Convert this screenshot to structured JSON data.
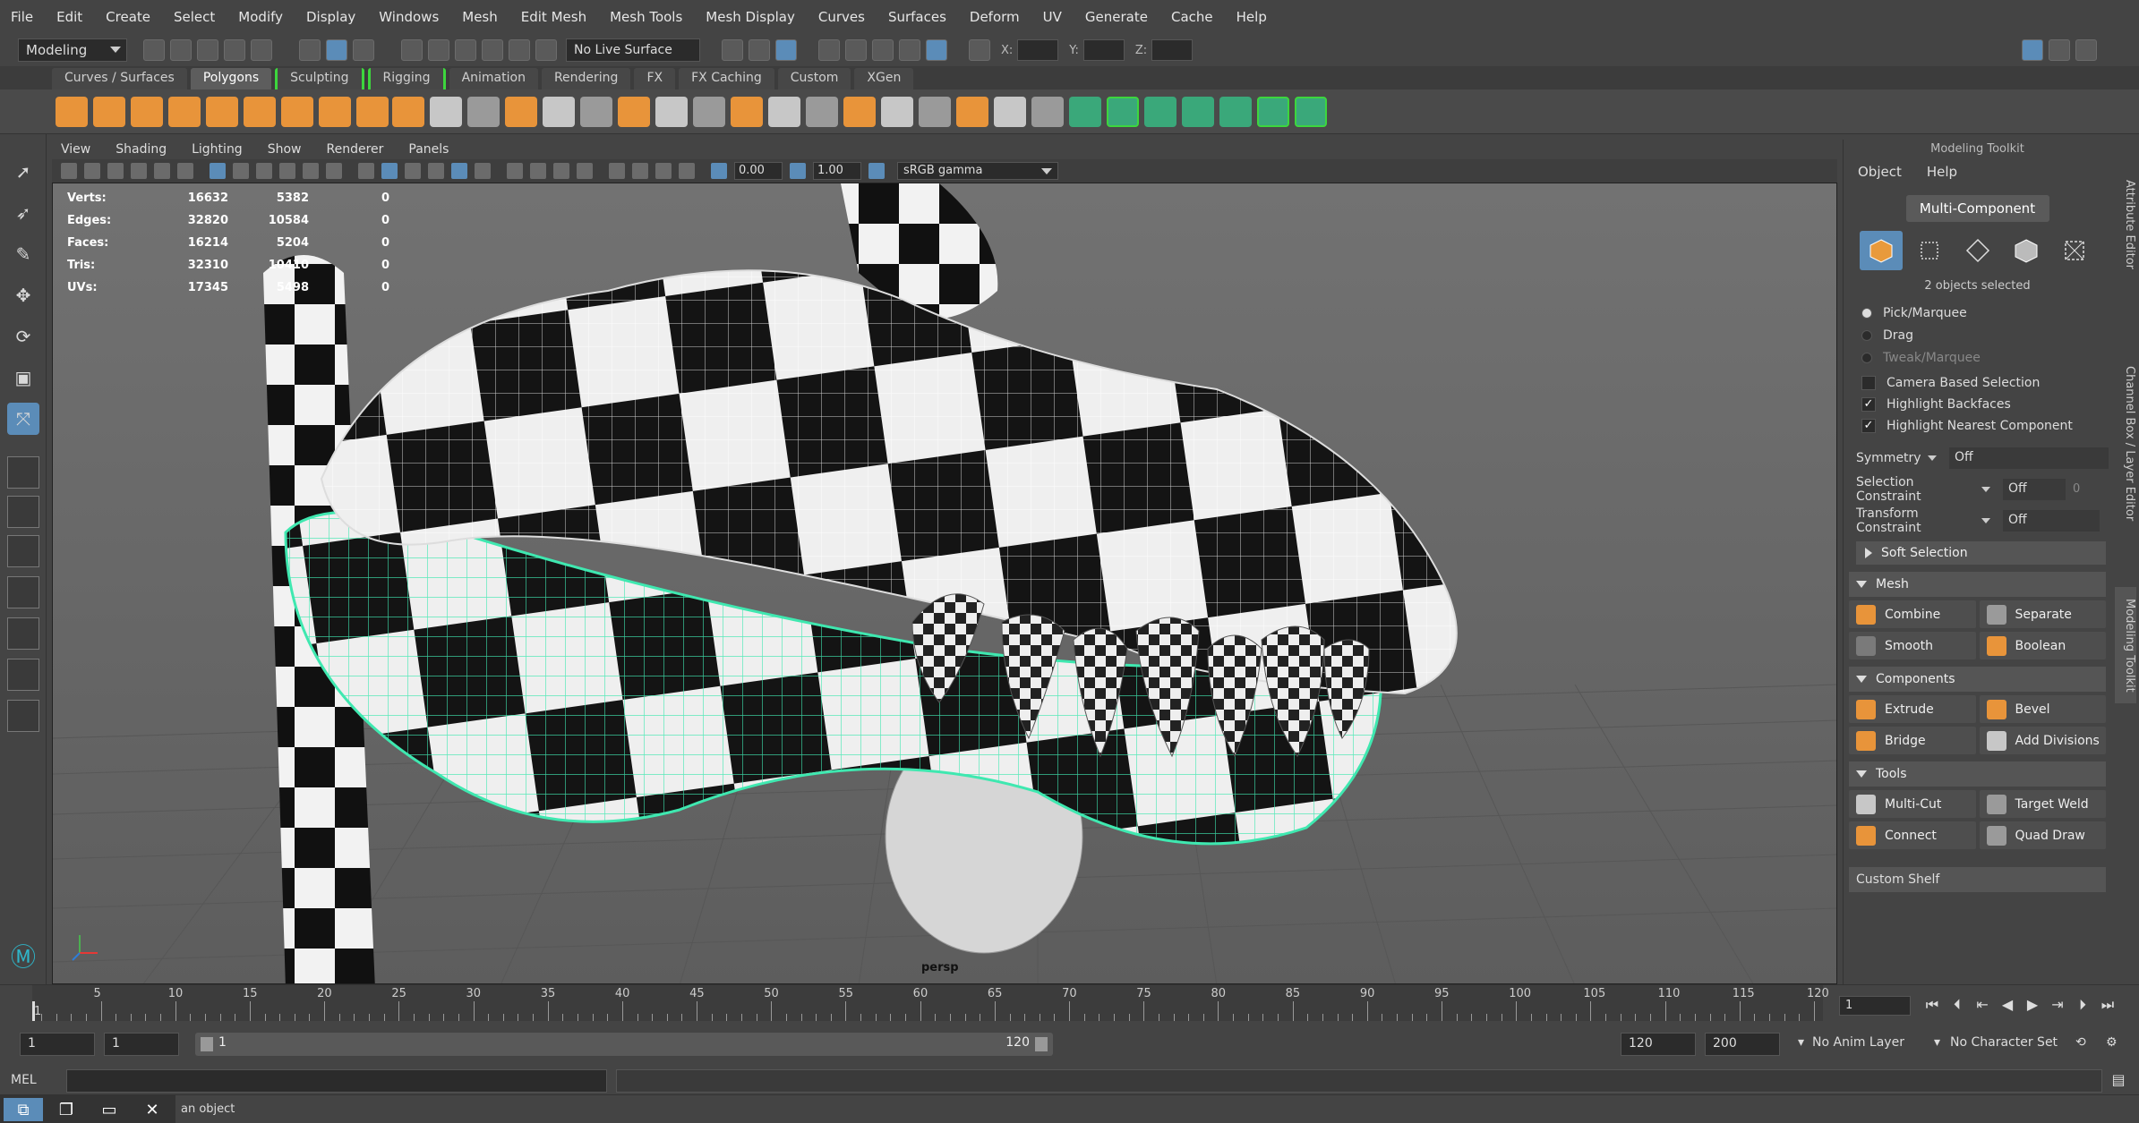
{
  "menubar": [
    "File",
    "Edit",
    "Create",
    "Select",
    "Modify",
    "Display",
    "Windows",
    "Mesh",
    "Edit Mesh",
    "Mesh Tools",
    "Mesh Display",
    "Curves",
    "Surfaces",
    "Deform",
    "UV",
    "Generate",
    "Cache",
    "Help"
  ],
  "status": {
    "mode": "Modeling",
    "live_surface": "No Live Surface",
    "x_label": "X:",
    "y_label": "Y:",
    "z_label": "Z:"
  },
  "shelf_tabs": [
    "Curves / Surfaces",
    "Polygons",
    "Sculpting",
    "Rigging",
    "Animation",
    "Rendering",
    "FX",
    "FX Caching",
    "Custom",
    "XGen"
  ],
  "panel_menu": [
    "View",
    "Shading",
    "Lighting",
    "Show",
    "Renderer",
    "Panels"
  ],
  "panel_toolbar": {
    "exposure": "0.00",
    "gamma": "1.00",
    "color_space": "sRGB gamma"
  },
  "hud": [
    {
      "label": "Verts:",
      "v1": "16632",
      "v2": "5382",
      "v3": "0"
    },
    {
      "label": "Edges:",
      "v1": "32820",
      "v2": "10584",
      "v3": "0"
    },
    {
      "label": "Faces:",
      "v1": "16214",
      "v2": "5204",
      "v3": "0"
    },
    {
      "label": "Tris:",
      "v1": "32310",
      "v2": "10410",
      "v3": "0"
    },
    {
      "label": "UVs:",
      "v1": "17345",
      "v2": "5498",
      "v3": "0"
    }
  ],
  "camera": "persp",
  "toolkit": {
    "title": "Modeling Toolkit",
    "menu": [
      "Object",
      "Help"
    ],
    "multi_component": "Multi-Component",
    "selection_info": "2 objects selected",
    "radios": [
      {
        "label": "Pick/Marquee",
        "on": true
      },
      {
        "label": "Drag",
        "on": false
      },
      {
        "label": "Tweak/Marquee",
        "on": false,
        "dim": true
      }
    ],
    "checks": [
      {
        "label": "Camera Based Selection",
        "checked": false
      },
      {
        "label": "Highlight Backfaces",
        "checked": true
      },
      {
        "label": "Highlight Nearest Component",
        "checked": true
      }
    ],
    "symmetry": {
      "label": "Symmetry",
      "value": "Off"
    },
    "selection_constraint": {
      "label": "Selection Constraint",
      "value": "Off",
      "num": "0"
    },
    "transform_constraint": {
      "label": "Transform Constraint",
      "value": "Off"
    },
    "soft_selection": "Soft Selection",
    "mesh": {
      "header": "Mesh",
      "buttons": [
        "Combine",
        "Separate",
        "Smooth",
        "Boolean"
      ]
    },
    "components": {
      "header": "Components",
      "buttons": [
        "Extrude",
        "Bevel",
        "Bridge",
        "Add Divisions"
      ]
    },
    "tools": {
      "header": "Tools",
      "buttons": [
        "Multi-Cut",
        "Target Weld",
        "Connect",
        "Quad Draw"
      ]
    },
    "custom_shelf": "Custom Shelf"
  },
  "right_tabs": [
    "Attribute Editor",
    "Channel Box / Layer Editor",
    "Modeling Toolkit"
  ],
  "timeline": {
    "ticks": [
      "5",
      "10",
      "15",
      "20",
      "25",
      "30",
      "35",
      "40",
      "45",
      "50",
      "55",
      "60",
      "65",
      "70",
      "75",
      "80",
      "85",
      "90",
      "95",
      "100",
      "105",
      "110",
      "115",
      "120"
    ],
    "current_frame": "1",
    "start_label": "1"
  },
  "range": {
    "start": "1",
    "start2": "1",
    "slider_start": "1",
    "slider_end": "120",
    "end": "120",
    "end2": "200",
    "anim_layer": "No Anim Layer",
    "char_set": "No Character Set"
  },
  "cmd": {
    "mel": "MEL"
  },
  "help_text": "an object"
}
